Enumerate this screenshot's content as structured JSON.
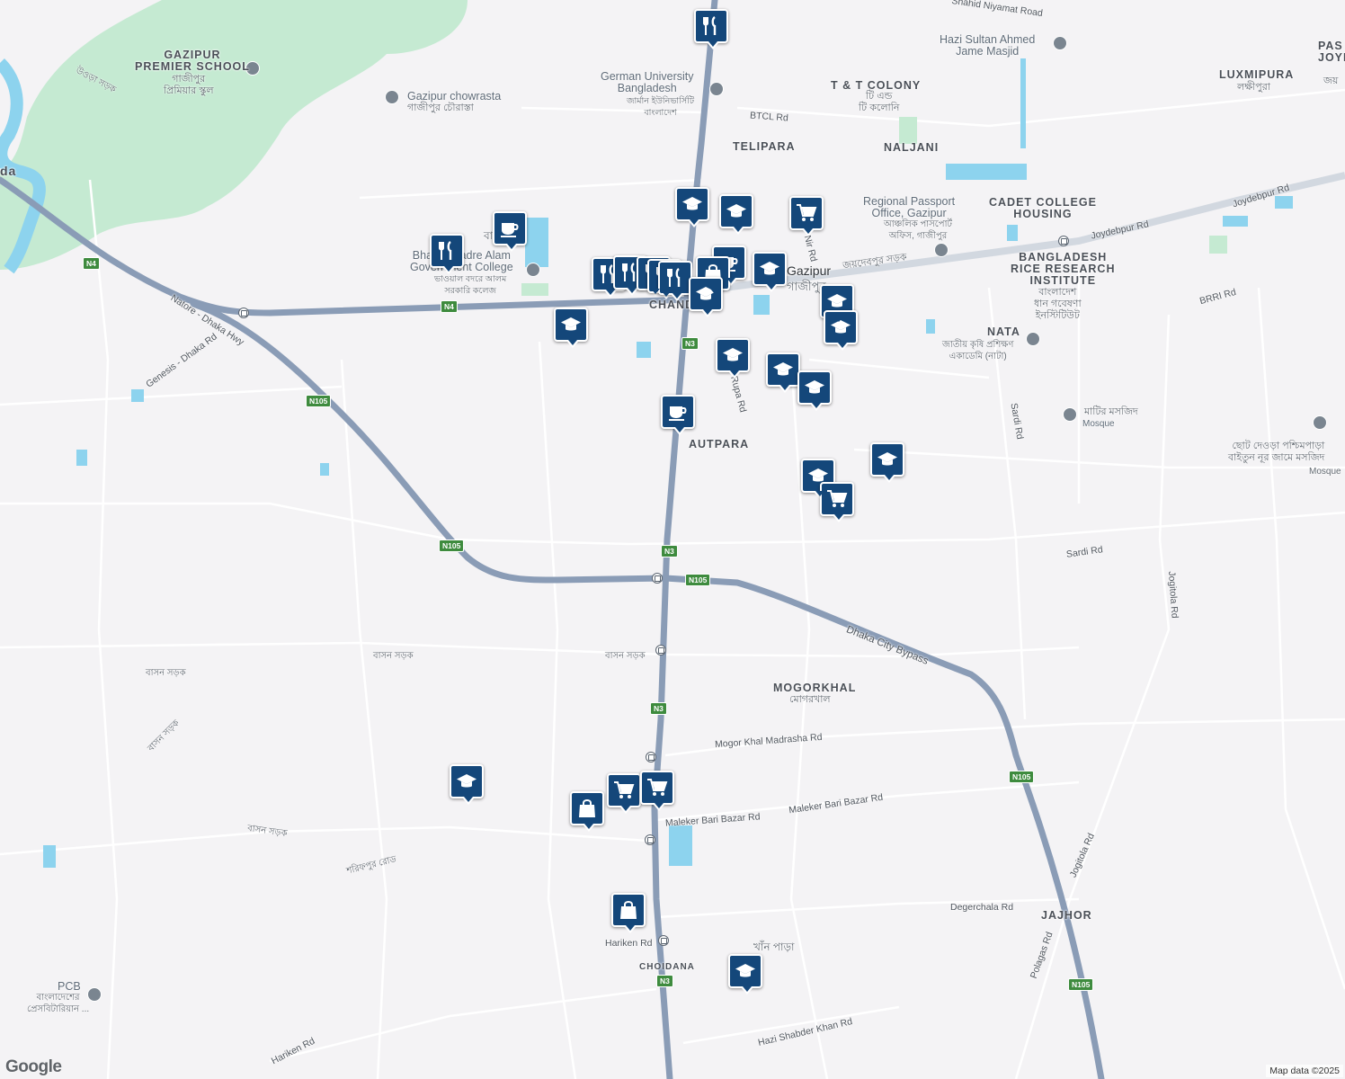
{
  "map": {
    "attribution": "Map data ©2025",
    "logo": "Google",
    "colors": {
      "land": "#f4f3f5",
      "park": "#c5ead2",
      "water": "#8dd3ee",
      "highway": "#8a9cb6",
      "road": "#ffffff",
      "pin": "#14477a",
      "shield": "#3e8b3e"
    },
    "area_labels": [
      {
        "text": "GAZIPUR\nPREMIER SCHOOL"
      },
      {
        "text": "T & T COLONY"
      },
      {
        "text": "TELIPARA"
      },
      {
        "text": "NALJANI"
      },
      {
        "text": "CADET COLLEGE\nHOUSING"
      },
      {
        "text": "BANGLADESH\nRICE RESEARCH\nINSTITUTE"
      },
      {
        "text": "LUXMIPURA"
      },
      {
        "text": "PAS\nJOYD"
      },
      {
        "text": "AUTPARA"
      },
      {
        "text": "MOGORKHAL"
      },
      {
        "text": "JAJHOR"
      },
      {
        "text": "CHOIDANA"
      },
      {
        "text": "CHAND"
      },
      {
        "text": "NATA"
      },
      {
        "text": "da"
      }
    ],
    "poi_labels": [
      {
        "text": "Gazipur chowrasta"
      },
      {
        "text": "German University\nBangladesh"
      },
      {
        "text": "Hazi Sultan Ahmed\nJame Masjid"
      },
      {
        "text": "Regional Passport\nOffice, Gazipur"
      },
      {
        "text": "Bhawal Badre Alam\nGovernment College"
      },
      {
        "text": "Mosque"
      },
      {
        "text": "PCB"
      },
      {
        "text": "Gazipur"
      }
    ],
    "bangla_labels": [
      {
        "text": "গাজীপুর\nপ্রিমিয়ার স্কুল"
      },
      {
        "text": "গাজীপুর চৌরাস্তা"
      },
      {
        "text": "জার্মান ইউনিভার্সিটি\nবাংলাদেশ"
      },
      {
        "text": "টি এন্ড\nটি কলোনি"
      },
      {
        "text": "আঞ্চলিক পাসপোর্ট\nঅফিস, গাজীপুর"
      },
      {
        "text": "জয়দেবপুর সড়ক"
      },
      {
        "text": "গাজীপুর"
      },
      {
        "text": "বাংলাদেশ\nধান গবেষণা\nইনস্টিটিউট"
      },
      {
        "text": "জাতীয় কৃষি প্রশিক্ষণ\nএকাডেমি (নাটা)"
      },
      {
        "text": "মাটির মসজিদ"
      },
      {
        "text": "ছোট দেওড়া পশ্চিমপাড়া\nবাইতুন নূর জামে মসজিদ"
      },
      {
        "text": "লক্ষীপুরা"
      },
      {
        "text": "জয়"
      },
      {
        "text": "ভাওয়াল বদরে আলম\nসরকারি কলেজ"
      },
      {
        "text": "মোগরখাল"
      },
      {
        "text": "খাঁন পাড়া"
      },
      {
        "text": "বাংলাদেশের\nপ্রেসবিটারিয়ান ..."
      },
      {
        "text": "বাসন সড়ক"
      },
      {
        "text": "বাসন সড়ক"
      },
      {
        "text": "বাসন সড়ক"
      },
      {
        "text": "বাসন সড়ক"
      },
      {
        "text": "বাসন সড়ক"
      },
      {
        "text": "শরিফপুর রোড"
      },
      {
        "text": "উওড়া সড়ক"
      },
      {
        "text": "বাংলাদেশ"
      },
      {
        "text": "Mosque"
      }
    ],
    "road_labels": [
      {
        "text": "Shahid Niyamat Road"
      },
      {
        "text": "BTCL Rd"
      },
      {
        "text": "Joydebpur Rd"
      },
      {
        "text": "Joydebpur Rd"
      },
      {
        "text": "BRRI Rd"
      },
      {
        "text": "Natore - Dhaka Hwy"
      },
      {
        "text": "Genesis - Dhaka Rd"
      },
      {
        "text": "Sardi Rd"
      },
      {
        "text": "Sardi Rd"
      },
      {
        "text": "Jogitola Rd"
      },
      {
        "text": "Jogitola Rd"
      },
      {
        "text": "Dhaka City Bypass"
      },
      {
        "text": "Mogor Khal Madrasha Rd"
      },
      {
        "text": "Maleker Bari Bazar Rd"
      },
      {
        "text": "Maleker Bari Bazar Rd"
      },
      {
        "text": "Degerchala Rd"
      },
      {
        "text": "Polagas Rd"
      },
      {
        "text": "Hariken Rd"
      },
      {
        "text": "Hariken Rd"
      },
      {
        "text": "Hazi Shabder Khan Rd"
      },
      {
        "text": "Rupa Rd"
      },
      {
        "text": "Nir Rd"
      }
    ],
    "shields": [
      "N4",
      "N4",
      "N3",
      "N105",
      "N105",
      "N3",
      "N105",
      "N3",
      "N105",
      "N3",
      "N105"
    ],
    "markers": [
      {
        "icon": "restaurant"
      },
      {
        "icon": "school"
      },
      {
        "icon": "school"
      },
      {
        "icon": "shopping-cart"
      },
      {
        "icon": "cafe"
      },
      {
        "icon": "restaurant"
      },
      {
        "icon": "restaurant"
      },
      {
        "icon": "restaurant"
      },
      {
        "icon": "restaurant"
      },
      {
        "icon": "restaurant"
      },
      {
        "icon": "restaurant"
      },
      {
        "icon": "cafe"
      },
      {
        "icon": "shopping-bag"
      },
      {
        "icon": "school"
      },
      {
        "icon": "school"
      },
      {
        "icon": "school"
      },
      {
        "icon": "school"
      },
      {
        "icon": "school"
      },
      {
        "icon": "school"
      },
      {
        "icon": "school"
      },
      {
        "icon": "school"
      },
      {
        "icon": "cafe"
      },
      {
        "icon": "school"
      },
      {
        "icon": "school"
      },
      {
        "icon": "shopping-cart"
      },
      {
        "icon": "school"
      },
      {
        "icon": "shopping-cart"
      },
      {
        "icon": "shopping-cart"
      },
      {
        "icon": "shopping-bag"
      },
      {
        "icon": "shopping-bag"
      },
      {
        "icon": "school"
      }
    ]
  }
}
